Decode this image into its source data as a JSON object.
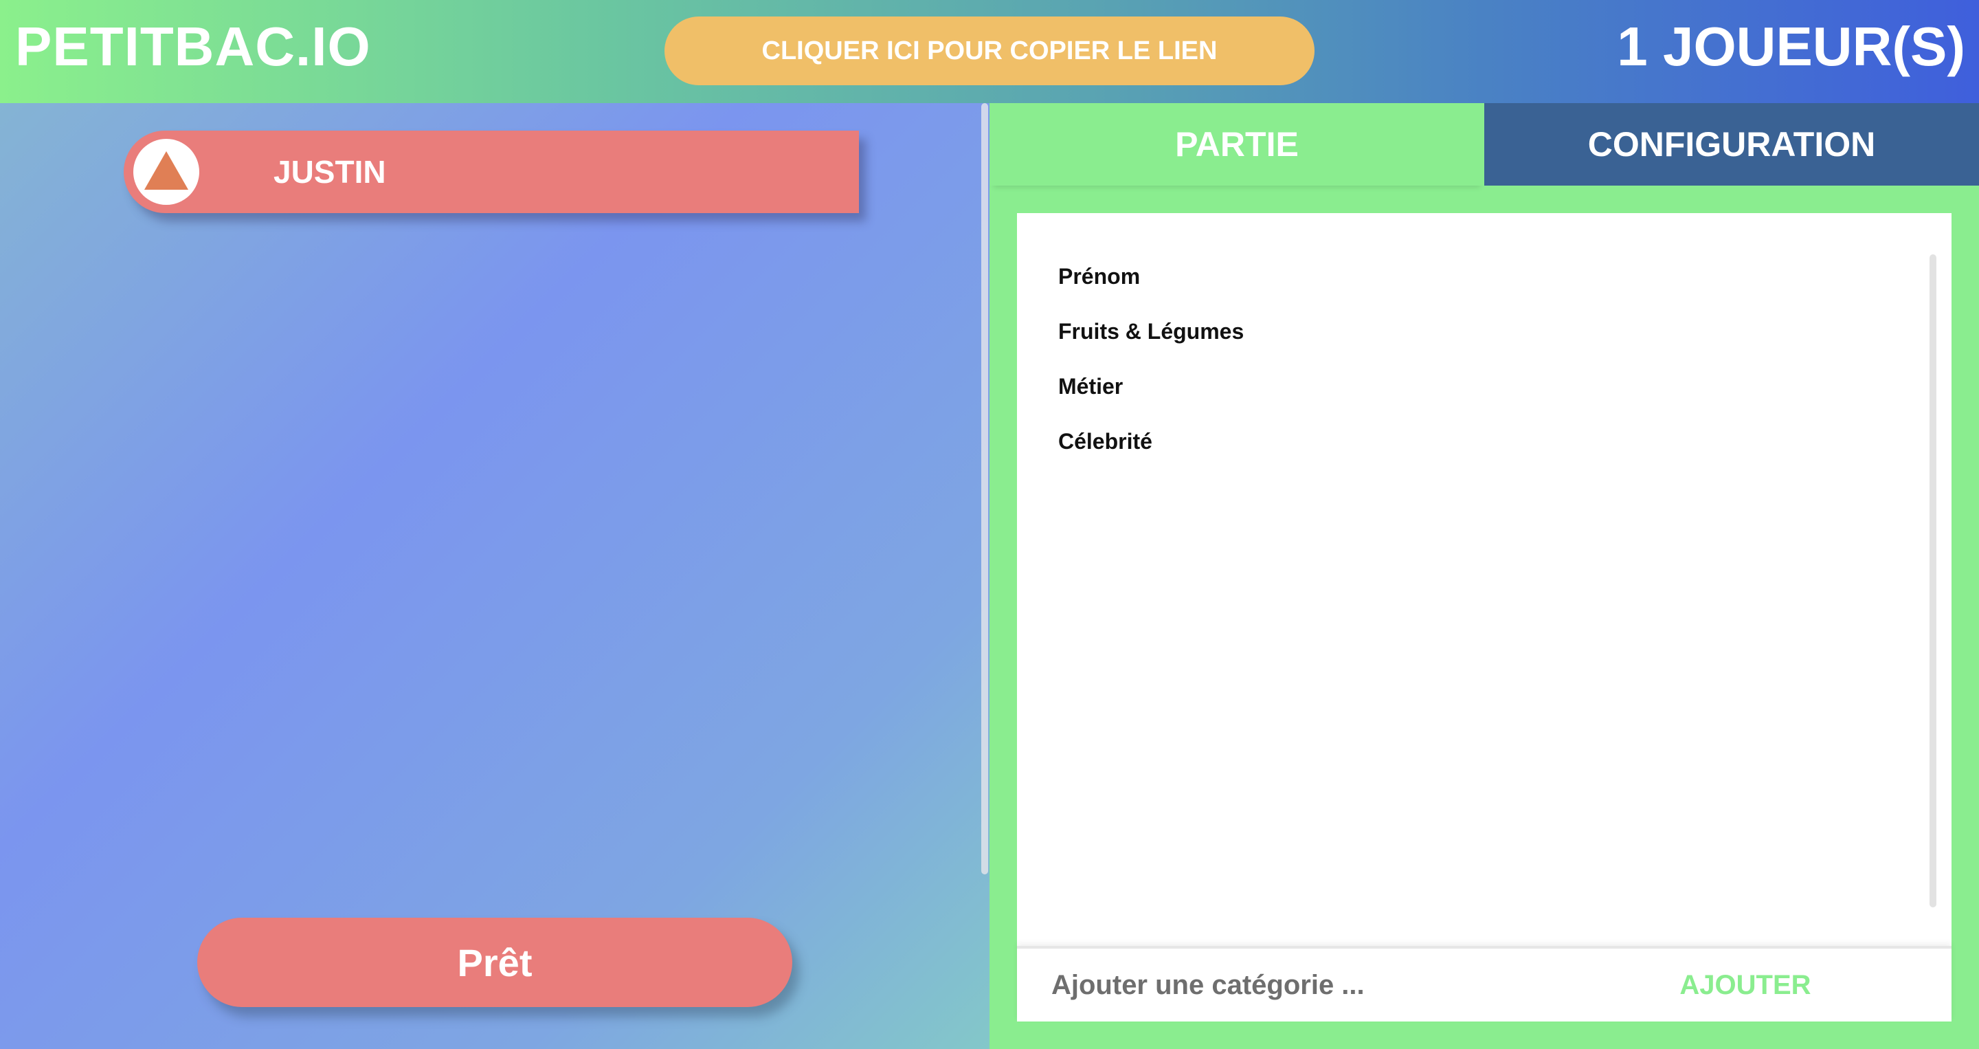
{
  "header": {
    "logo": "PETITBAC.IO",
    "copy_link_label": "CLIQUER ICI POUR COPIER LE LIEN",
    "player_count": "1 JOUEUR(S)"
  },
  "players": [
    {
      "name": "JUSTIN",
      "avatar_icon": "triangle-icon",
      "avatar_color": "#e07f55",
      "card_color": "#e97d7b"
    }
  ],
  "ready_button_label": "Prêt",
  "tabs": [
    {
      "label": "PARTIE",
      "active": true
    },
    {
      "label": "CONFIGURATION",
      "active": false
    }
  ],
  "categories": [
    "Prénom",
    "Fruits & Légumes",
    "Métier",
    "Célebrité"
  ],
  "add_category": {
    "placeholder": "Ajouter une catégorie ...",
    "button_label": "AJOUTER"
  },
  "colors": {
    "accent_green": "#8aed8f",
    "tab_config_blue": "#3a6294",
    "copy_button_yellow": "#f0bf68",
    "player_red": "#e97d7b"
  }
}
